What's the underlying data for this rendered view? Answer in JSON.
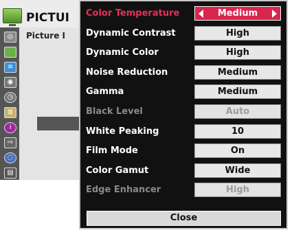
{
  "background_menu": {
    "title": "PICTUI",
    "subtitle": "Picture I"
  },
  "submenu": {
    "rows": [
      {
        "label": "Color Temperature",
        "value": "Medium",
        "state": "selected"
      },
      {
        "label": "Dynamic Contrast",
        "value": "High",
        "state": "normal"
      },
      {
        "label": "Dynamic Color",
        "value": "High",
        "state": "normal"
      },
      {
        "label": "Noise Reduction",
        "value": "Medium",
        "state": "normal"
      },
      {
        "label": "Gamma",
        "value": "Medium",
        "state": "normal"
      },
      {
        "label": "Black Level",
        "value": "Auto",
        "state": "disabled"
      },
      {
        "label": "White Peaking",
        "value": "10",
        "state": "normal"
      },
      {
        "label": "Film Mode",
        "value": "On",
        "state": "normal"
      },
      {
        "label": "Color Gamut",
        "value": "Wide",
        "state": "normal"
      },
      {
        "label": "Edge Enhancer",
        "value": "High",
        "state": "disabled"
      }
    ],
    "close_label": "Close"
  },
  "colors": {
    "selected_accent": "#d8264d",
    "menu_background": "#111111",
    "disabled_text": "#8a8a8a"
  },
  "icons": [
    "tv-icon",
    "picture-icon",
    "screen-icon",
    "audio-icon",
    "time-icon",
    "option-icon",
    "info-icon",
    "input-icon",
    "usb-icon",
    "media-icon"
  ]
}
